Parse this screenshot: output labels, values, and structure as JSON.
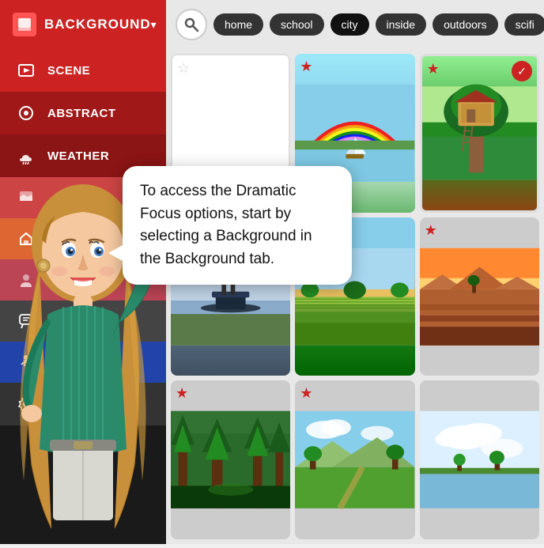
{
  "sidebar": {
    "title": "BACKGROUND",
    "chevron": "▾",
    "items": [
      {
        "id": "scene",
        "label": "SCENE",
        "icon": "🎬"
      },
      {
        "id": "abstract",
        "label": "ABSTRACT",
        "icon": "🌀"
      },
      {
        "id": "weather",
        "label": "WEATHER",
        "icon": "🌧"
      },
      {
        "id": "item4",
        "label": "",
        "icon": ""
      },
      {
        "id": "item5",
        "label": "",
        "icon": "🏠"
      },
      {
        "id": "item6",
        "label": "",
        "icon": ""
      },
      {
        "id": "item7",
        "label": "",
        "icon": "💬"
      },
      {
        "id": "item8",
        "label": "",
        "icon": "🚶"
      },
      {
        "id": "item9",
        "label": "",
        "icon": "⚙"
      }
    ]
  },
  "topbar": {
    "search_placeholder": "Search",
    "filters": [
      "home",
      "school",
      "city",
      "inside",
      "outdoors",
      "scifi"
    ]
  },
  "grid": {
    "cells": [
      {
        "id": 1,
        "star": "empty",
        "selected": false
      },
      {
        "id": 2,
        "star": "filled",
        "selected": false
      },
      {
        "id": 3,
        "star": "filled",
        "selected": true
      },
      {
        "id": 4,
        "star": "filled",
        "selected": false
      },
      {
        "id": 5,
        "star": false,
        "selected": false
      },
      {
        "id": 6,
        "star": "filled",
        "selected": false
      },
      {
        "id": 7,
        "star": "filled",
        "selected": false
      },
      {
        "id": 8,
        "star": "filled",
        "selected": false
      },
      {
        "id": 9,
        "star": false,
        "selected": false
      }
    ]
  },
  "speech_bubble": {
    "text": "To access the Dramatic Focus options, start by selecting a Background in the Background tab."
  },
  "icons": {
    "search": "🔍",
    "star_filled": "★",
    "star_empty": "☆",
    "checkmark": "✓",
    "scene_icon": "🎬",
    "abstract_icon": "◎",
    "weather_icon": "🌧",
    "background_icon": "🖼",
    "chevron_down": "▾"
  }
}
